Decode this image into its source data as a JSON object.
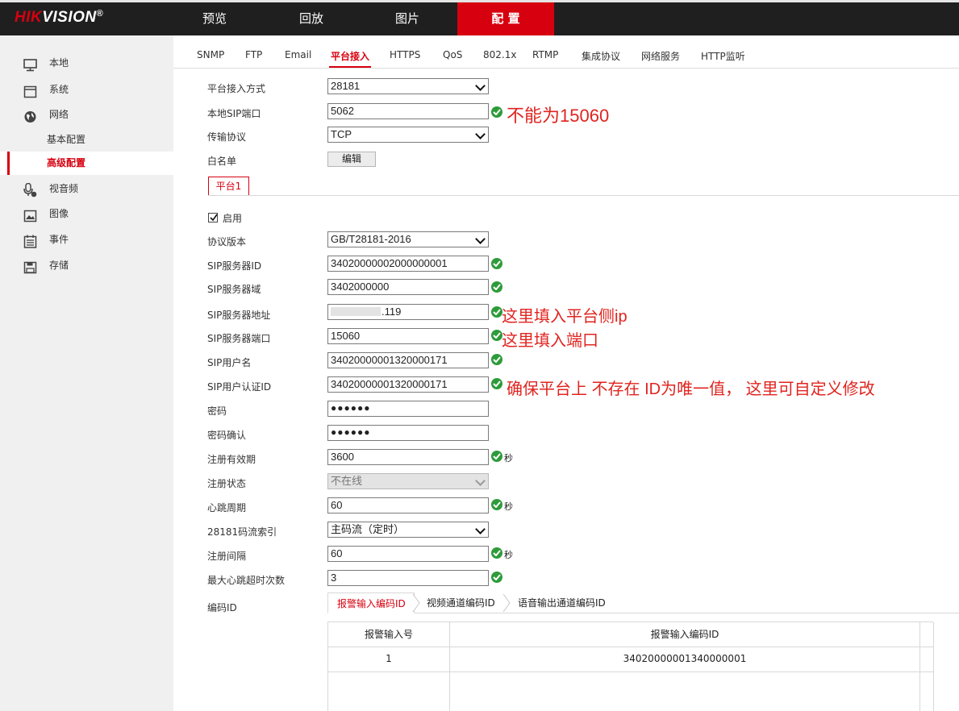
{
  "header": {
    "logo_hik": "HIK",
    "logo_vision": "VISION",
    "logo_reg": "®",
    "nav": [
      "预览",
      "回放",
      "图片",
      "配 置"
    ]
  },
  "sidebar": {
    "items": [
      {
        "label": "本地",
        "icon": "monitor-icon"
      },
      {
        "label": "系统",
        "icon": "window-icon"
      },
      {
        "label": "网络",
        "icon": "globe-icon"
      },
      {
        "label": "基本配置",
        "icon": ""
      },
      {
        "label": "高级配置",
        "icon": ""
      },
      {
        "label": "视音频",
        "icon": "audio-video-icon"
      },
      {
        "label": "图像",
        "icon": "image-icon"
      },
      {
        "label": "事件",
        "icon": "calendar-icon"
      },
      {
        "label": "存储",
        "icon": "floppy-icon"
      }
    ]
  },
  "tabs": [
    "SNMP",
    "FTP",
    "Email",
    "平台接入",
    "HTTPS",
    "QoS",
    "802.1x",
    "RTMP",
    "集成协议",
    "网络服务",
    "HTTP监听"
  ],
  "form": {
    "access_mode_label": "平台接入方式",
    "access_mode_value": "28181",
    "sip_port_label": "本地SIP端口",
    "sip_port_value": "5062",
    "transport_label": "传输协议",
    "transport_value": "TCP",
    "whitelist_label": "白名单",
    "whitelist_button": "编辑"
  },
  "platform_tab": "平台1",
  "enable_label": "启用",
  "platform": {
    "protocol_version_label": "协议版本",
    "protocol_version_value": "GB/T28181-2016",
    "sip_server_id_label": "SIP服务器ID",
    "sip_server_id_value": "34020000002000000001",
    "sip_domain_label": "SIP服务器域",
    "sip_domain_value": "3402000000",
    "sip_addr_label": "SIP服务器地址",
    "sip_addr_value": ".119",
    "sip_server_port_label": "SIP服务器端口",
    "sip_server_port_value": "15060",
    "sip_user_label": "SIP用户名",
    "sip_user_value": "34020000001320000171",
    "sip_auth_label": "SIP用户认证ID",
    "sip_auth_value": "34020000001320000171",
    "password_label": "密码",
    "password_value": "●●●●●●",
    "password_confirm_label": "密码确认",
    "password_confirm_value": "●●●●●●",
    "reg_period_label": "注册有效期",
    "reg_period_value": "3600",
    "reg_status_label": "注册状态",
    "reg_status_value": "不在线",
    "heartbeat_label": "心跳周期",
    "heartbeat_value": "60",
    "stream_index_label": "28181码流索引",
    "stream_index_value": "主码流（定时）",
    "reg_interval_label": "注册间隔",
    "reg_interval_value": "60",
    "max_timeout_label": "最大心跳超时次数",
    "max_timeout_value": "3",
    "code_id_label": "编码ID",
    "unit_seconds": "秒"
  },
  "subtabs": [
    "报警输入编码ID",
    "视频通道编码ID",
    "语音输出通道编码ID"
  ],
  "table": {
    "headers": [
      "报警输入号",
      "报警输入编码ID"
    ],
    "rows": [
      [
        "1",
        "34020000001340000001"
      ]
    ]
  },
  "annotations": {
    "port_note": "不能为15060",
    "addr_note": "这里填入平台侧ip",
    "server_port_note": "这里填入端口",
    "auth_note": "确保平台上 不存在 ID为唯一值， 这里可自定义修改"
  },
  "colors": {
    "brand_red": "#d7000f",
    "annotation_red": "#e0241f",
    "ok_green": "#2e9b3a"
  }
}
